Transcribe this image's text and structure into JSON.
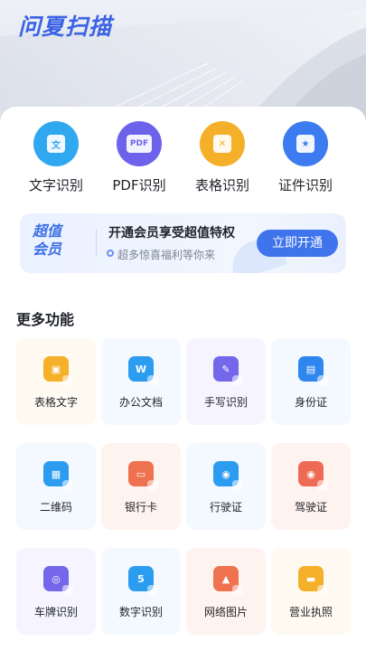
{
  "app": {
    "title": "问夏扫描"
  },
  "quick_actions": [
    {
      "label": "文字识别",
      "icon": "text-recognition-icon",
      "color": "#2fa8f0",
      "glyph": "文"
    },
    {
      "label": "PDF识别",
      "icon": "pdf-icon",
      "color": "#6c63ea",
      "glyph": "PDF"
    },
    {
      "label": "表格识别",
      "icon": "table-recognition-icon",
      "color": "#f5b02a",
      "glyph": "✕"
    },
    {
      "label": "证件识别",
      "icon": "id-card-icon",
      "color": "#3d7cf0",
      "glyph": "★"
    }
  ],
  "vip": {
    "badge_line1": "超值",
    "badge_line2": "会员",
    "title": "开通会员享受超值特权",
    "subtitle": "超多惊喜福利等你来",
    "button": "立即开通"
  },
  "more": {
    "title": "更多功能",
    "items": [
      {
        "label": "表格文字",
        "icon": "camera-icon",
        "color": "#f5b02a",
        "bg": "#fffaf1",
        "glyph": "▣"
      },
      {
        "label": "办公文档",
        "icon": "word-doc-icon",
        "color": "#2c9cf0",
        "bg": "#f4f8ff",
        "glyph": "W"
      },
      {
        "label": "手写识别",
        "icon": "pen-icon",
        "color": "#7467e9",
        "bg": "#f6f5ff",
        "glyph": "✎"
      },
      {
        "label": "身份证",
        "icon": "id-card-icon",
        "color": "#2f86ee",
        "bg": "#f4f8ff",
        "glyph": "▤"
      },
      {
        "label": "二维码",
        "icon": "qr-code-icon",
        "color": "#2c9cf0",
        "bg": "#f4f8ff",
        "glyph": "▦"
      },
      {
        "label": "银行卡",
        "icon": "bank-card-icon",
        "color": "#ef7250",
        "bg": "#fff3ef",
        "glyph": "▭"
      },
      {
        "label": "行驶证",
        "icon": "vehicle-license-icon",
        "color": "#2c9cf0",
        "bg": "#f4f8ff",
        "glyph": "◉"
      },
      {
        "label": "驾驶证",
        "icon": "driver-license-icon",
        "color": "#ef6a55",
        "bg": "#fff3ef",
        "glyph": "◉"
      },
      {
        "label": "车牌识别",
        "icon": "license-plate-icon",
        "color": "#7467e9",
        "bg": "#f6f5ff",
        "glyph": "◎"
      },
      {
        "label": "数字识别",
        "icon": "number-icon",
        "color": "#2c9cf0",
        "bg": "#f4f8ff",
        "glyph": "5"
      },
      {
        "label": "网络图片",
        "icon": "image-icon",
        "color": "#ef7250",
        "bg": "#fff3ef",
        "glyph": "▲"
      },
      {
        "label": "营业执照",
        "icon": "business-license-icon",
        "color": "#f5b02a",
        "bg": "#fffaf1",
        "glyph": "▬"
      }
    ]
  }
}
